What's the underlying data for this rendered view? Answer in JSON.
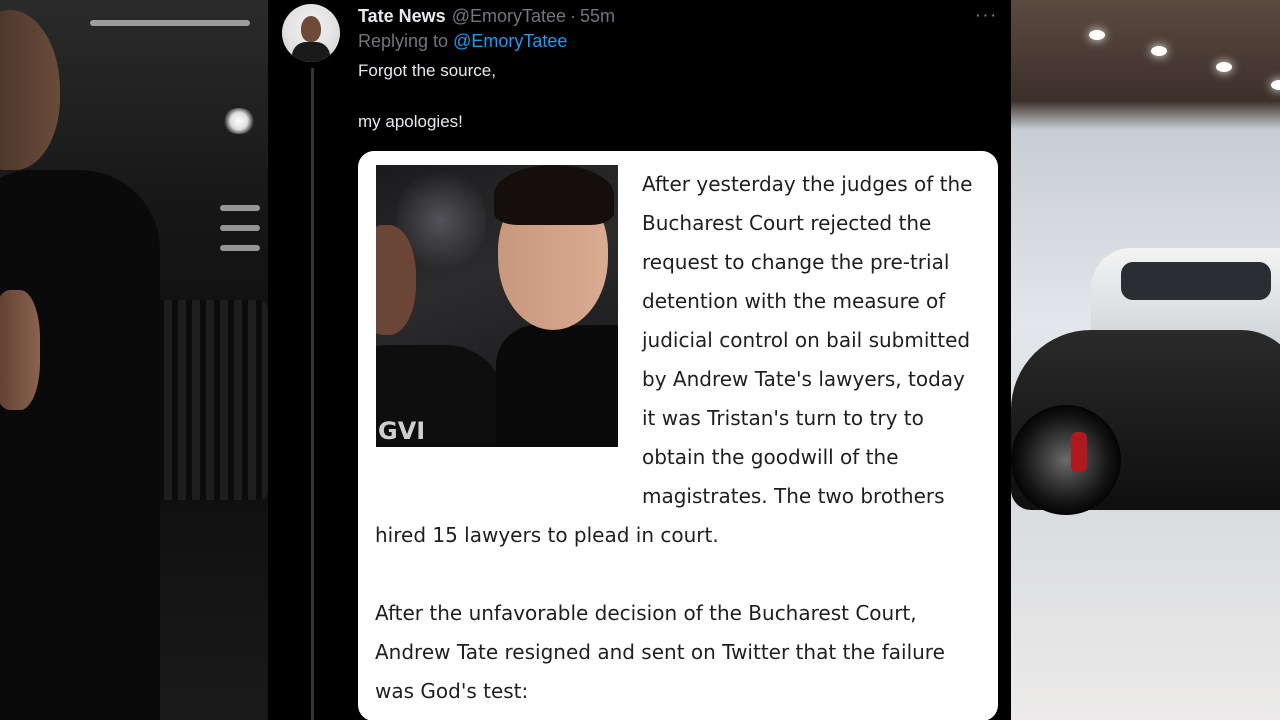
{
  "tweet": {
    "author_name": "Tate News",
    "author_handle": "@EmoryTatee",
    "separator": "·",
    "time": "55m",
    "replying_prefix": "Replying to",
    "replying_handle": "@EmoryTatee",
    "more_icon": "···",
    "text_lines": [
      "Forgot the source,",
      "my apologies!"
    ]
  },
  "card": {
    "photo_shirt_text": "GVI",
    "article_wrapped_lines": [
      "After yesterday the judges of the",
      "Bucharest Court rejected the",
      "request to change the pre-trial",
      "detention with the measure of",
      "judicial control on bail submitted",
      "by Andrew Tate's lawyers, today",
      "it was Tristan's turn to try to",
      "obtain the goodwill of the",
      "magistrates. The two brothers"
    ],
    "article_full_lines": [
      "hired 15 lawyers to plead in court.",
      "",
      "After the unfavorable decision of the Bucharest Court,",
      "Andrew Tate resigned and sent on Twitter that the failure",
      "was God's test:"
    ]
  },
  "colors": {
    "background": "#000000",
    "primary_text": "#e7e9ea",
    "secondary_text": "#71767b",
    "link": "#1d9bf0",
    "card_background": "#ffffff",
    "card_text": "#1f1f1f"
  }
}
